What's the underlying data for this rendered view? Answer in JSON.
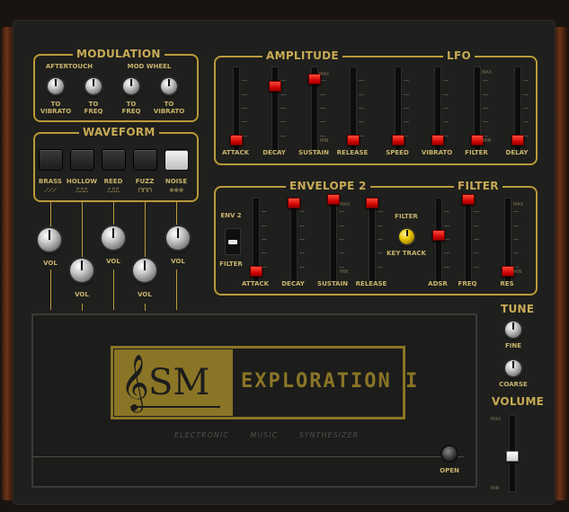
{
  "modulation": {
    "title": "MODULATION",
    "aftertouch": "AFTERTOUCH",
    "mod_wheel": "MOD WHEEL",
    "knobs": [
      {
        "line1": "TO",
        "line2": "VIBRATO"
      },
      {
        "line1": "TO",
        "line2": "FREQ"
      },
      {
        "line1": "TO",
        "line2": "FREQ"
      },
      {
        "line1": "TO",
        "line2": "VIBRATO"
      }
    ]
  },
  "waveform": {
    "title": "WAVEFORM",
    "buttons": [
      {
        "label": "BRASS",
        "wave": "⟋⟋⟋",
        "on": false
      },
      {
        "label": "HOLLOW",
        "wave": "⎍⎍⎍",
        "on": false
      },
      {
        "label": "REED",
        "wave": "⎍⎍⎍",
        "on": false
      },
      {
        "label": "FUZZ",
        "wave": "⊓⊓⊓",
        "on": false
      },
      {
        "label": "NOISE",
        "wave": "※※※",
        "on": true
      }
    ],
    "vol_label": "VOL"
  },
  "amplitude": {
    "title": "AMPLITUDE",
    "sliders": [
      {
        "label": "ATTACK",
        "level": 0.0
      },
      {
        "label": "DECAY",
        "level": 0.75
      },
      {
        "label": "SUSTAIN",
        "level": 0.85
      },
      {
        "label": "RELEASE",
        "level": 0.0
      }
    ],
    "max": "MAX",
    "min": "MIN"
  },
  "lfo": {
    "title": "LFO",
    "sliders": [
      {
        "label": "SPEED",
        "level": 0.0
      },
      {
        "label": "VIBRATO",
        "level": 0.0
      },
      {
        "label": "FILTER",
        "level": 0.0
      },
      {
        "label": "DELAY",
        "level": 0.0
      }
    ],
    "max": "MAX",
    "min": "MIN"
  },
  "envelope2": {
    "title": "ENVELOPE 2",
    "toggle_top": "ENV 2",
    "toggle_bottom": "FILTER",
    "sliders": [
      {
        "label": "ATTACK",
        "level": 0.0
      },
      {
        "label": "DECAY",
        "level": 0.95
      },
      {
        "label": "SUSTAIN",
        "level": 1.0
      },
      {
        "label": "RELEASE",
        "level": 0.95
      }
    ],
    "max": "MAX",
    "min": "MIN"
  },
  "filter": {
    "title": "FILTER",
    "knob_top": "FILTER",
    "knob_bottom": "KEY TRACK",
    "sliders": [
      {
        "label": "ADSR",
        "level": 0.5
      },
      {
        "label": "FREQ",
        "level": 1.0
      },
      {
        "label": "RES",
        "level": 0.0
      }
    ],
    "max": "MAX",
    "min": "MIN"
  },
  "display": {
    "brand": "SM",
    "clef": "𝄞",
    "model": "EXPLORATION I",
    "subtitle": "ELECTRONIC MUSIC SYNTHESIZER",
    "open": "OPEN"
  },
  "tune": {
    "title": "TUNE",
    "fine": "FINE",
    "coarse": "COARSE"
  },
  "volume": {
    "title": "VOLUME",
    "max": "MAX",
    "min": "MIN",
    "level": 0.45
  },
  "colors": {
    "accent": "#c7ab55",
    "slider_handle": "#e01010",
    "panel": "#1f1f1d"
  }
}
